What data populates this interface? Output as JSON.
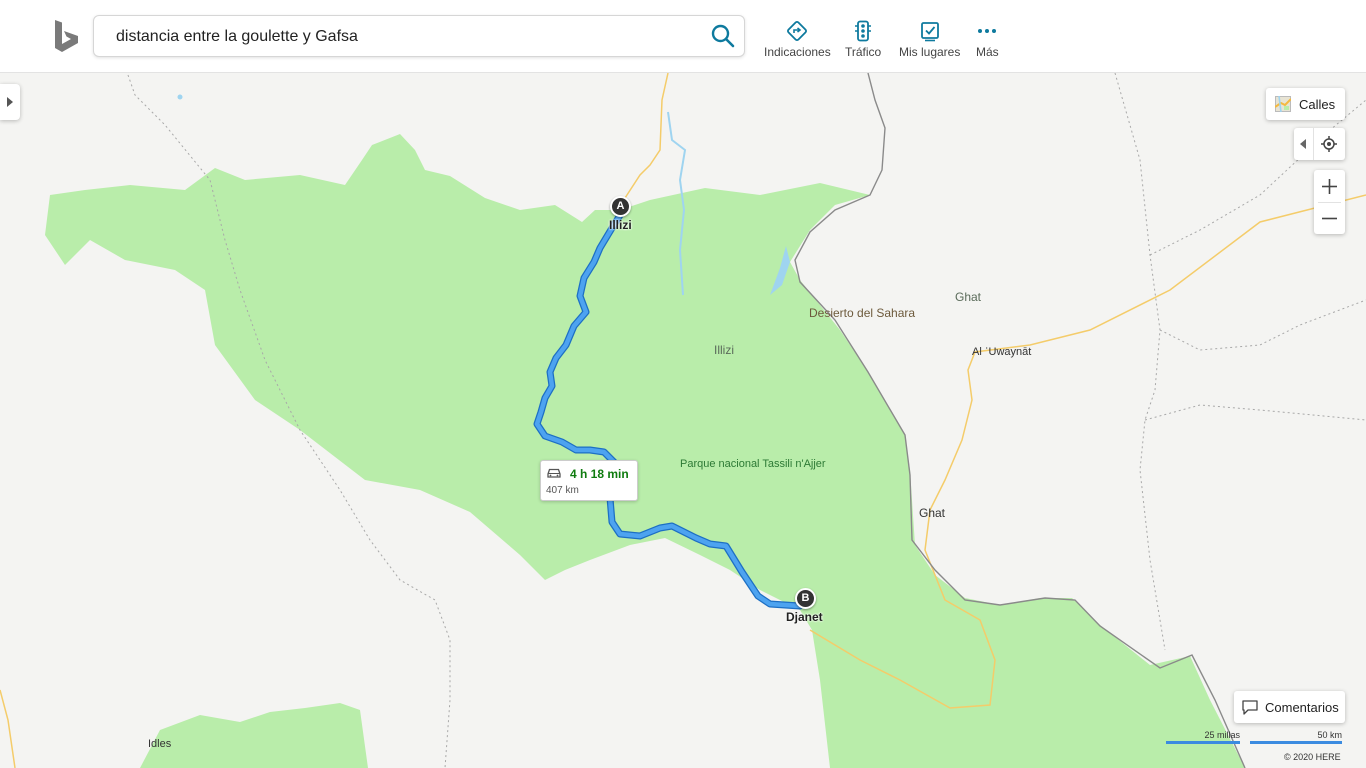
{
  "search": {
    "query": "distancia entre la goulette y Gafsa"
  },
  "nav": {
    "directions": "Indicaciones",
    "traffic": "Tráfico",
    "my_places": "Mis lugares",
    "more": "Más"
  },
  "map_controls": {
    "style_label": "Calles",
    "feedback_label": "Comentarios"
  },
  "route": {
    "duration": "4 h 18 min",
    "distance": "407 km"
  },
  "waypoints": {
    "a": {
      "marker": "A",
      "name": "Illizi"
    },
    "b": {
      "marker": "B",
      "name": "Djanet"
    }
  },
  "labels": {
    "region_illizi": "Illizi",
    "desert": "Desierto del Sahara",
    "park": "Parque nacional Tassili n'Ajjer",
    "ghat_region": "Ghat",
    "al_uwaynat": "Al ʿUwaynāt",
    "ghat_city": "Ghat",
    "idles": "Idles"
  },
  "scale": {
    "miles": "25 millas",
    "km": "50 km"
  },
  "attribution": "© 2020 HERE",
  "colors": {
    "park_green": "#b9edaa",
    "route_blue": "#3392e6",
    "brand_teal": "#0e7a9e"
  }
}
